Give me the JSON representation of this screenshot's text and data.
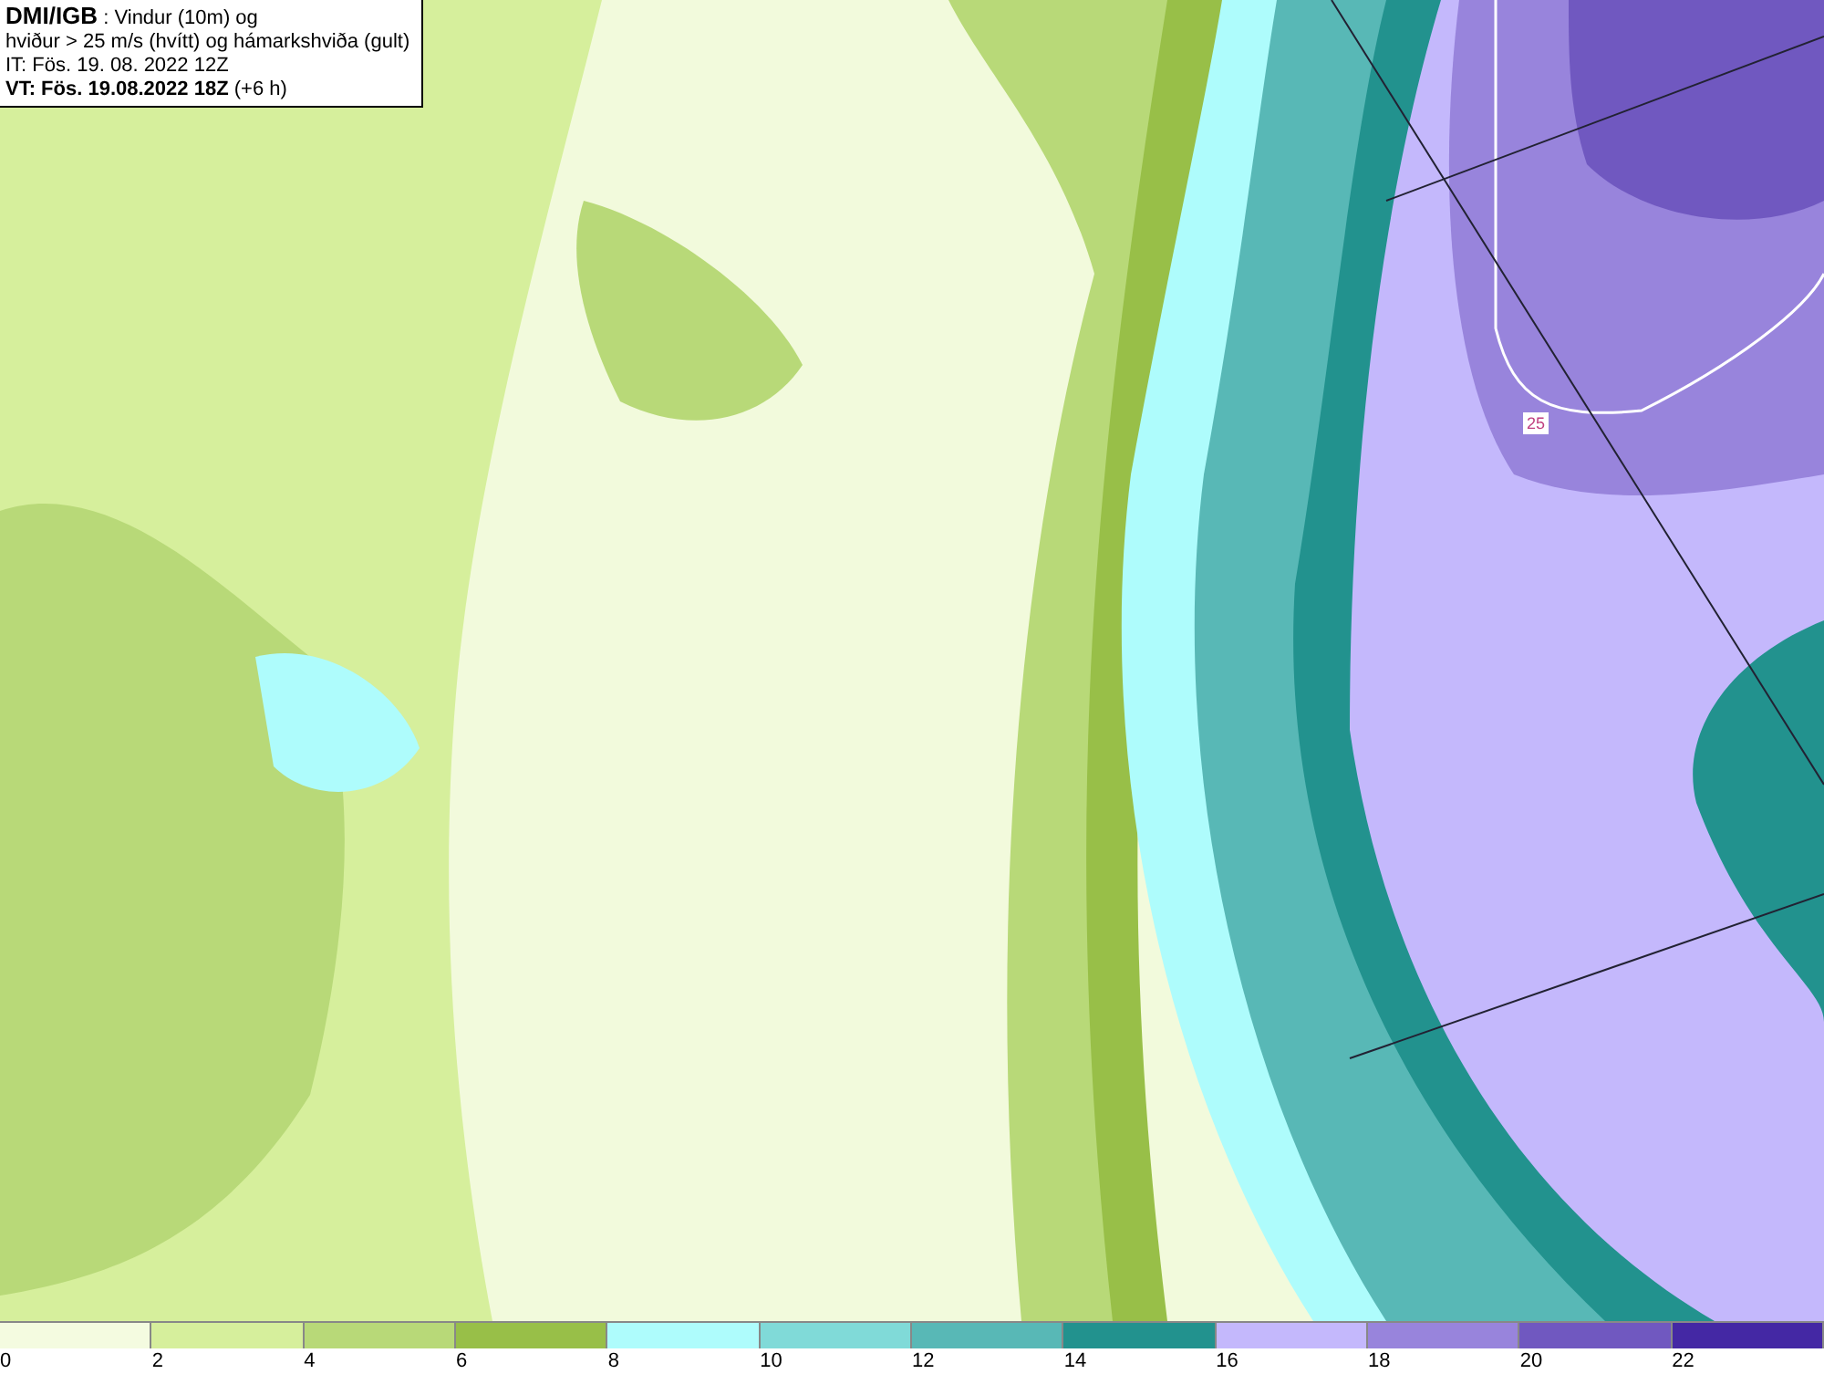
{
  "title_box": {
    "lines": [
      "**DMI/IGB** : Vindur (10m) og",
      "hviður > 25 m/s (hvítt) og hámarkshviða (gult)",
      "IT: Fös. 19. 08. 2022 12Z",
      "**VT: Fös. 19.08.2022 18Z** (+6 h)"
    ]
  },
  "map": {
    "contour_label": "25"
  },
  "legend": {
    "bins": [
      {
        "label": "0",
        "color": "#f4fbe0"
      },
      {
        "label": "2",
        "color": "#d6ef9c"
      },
      {
        "label": "4",
        "color": "#b8d978"
      },
      {
        "label": "6",
        "color": "#98bf48"
      },
      {
        "label": "8",
        "color": "#aefcfc"
      },
      {
        "label": "10",
        "color": "#80dad8"
      },
      {
        "label": "12",
        "color": "#58b8b6"
      },
      {
        "label": "14",
        "color": "#22928e"
      },
      {
        "label": "16",
        "color": "#c4b8fc"
      },
      {
        "label": "18",
        "color": "#9884dc"
      },
      {
        "label": "20",
        "color": "#7058c0"
      },
      {
        "label": "22",
        "color": "#4428a4"
      }
    ]
  }
}
